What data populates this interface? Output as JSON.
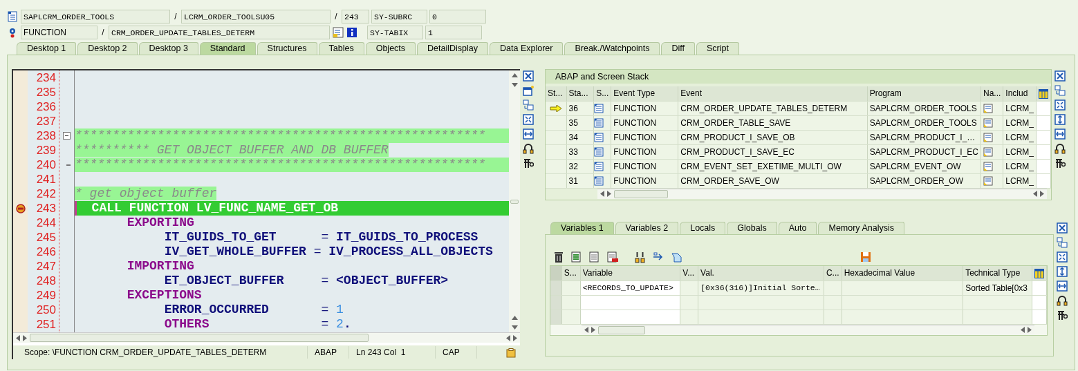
{
  "header": {
    "program": "SAPLCRM_ORDER_TOOLS",
    "include": "LCRM_ORDER_TOOLSU05",
    "line": "243",
    "event_type": "FUNCTION",
    "event": "CRM_ORDER_UPDATE_TABLES_DETERM",
    "separators": [
      "/",
      "/",
      "/"
    ],
    "sys_fields": [
      {
        "name": "SY-SUBRC",
        "value": "0"
      },
      {
        "name": "SY-TABIX",
        "value": "1"
      }
    ]
  },
  "tabs": [
    {
      "label": "Desktop 1",
      "selected": false
    },
    {
      "label": "Desktop 2",
      "selected": false
    },
    {
      "label": "Desktop 3",
      "selected": false
    },
    {
      "label": "Standard",
      "selected": true
    },
    {
      "label": "Structures",
      "selected": false
    },
    {
      "label": "Tables",
      "selected": false
    },
    {
      "label": "Objects",
      "selected": false
    },
    {
      "label": "DetailDisplay",
      "selected": false
    },
    {
      "label": "Data Explorer",
      "selected": false
    },
    {
      "label": "Break./Watchpoints",
      "selected": false
    },
    {
      "label": "Diff",
      "selected": false
    },
    {
      "label": "Script",
      "selected": false
    }
  ],
  "code": {
    "lines": [
      {
        "number": "234",
        "breakpoint": false,
        "collapsible": false,
        "kind": "blank"
      },
      {
        "number": "235",
        "breakpoint": false,
        "collapsible": false,
        "kind": "blank"
      },
      {
        "number": "236",
        "breakpoint": false,
        "collapsible": false,
        "kind": "blank"
      },
      {
        "number": "237",
        "breakpoint": false,
        "collapsible": false,
        "kind": "blank"
      },
      {
        "number": "238",
        "breakpoint": false,
        "collapsible": true,
        "kind": "banner-rule",
        "tokens": [
          {
            "text": "*******************************************************",
            "kind": "comment"
          }
        ]
      },
      {
        "number": "239",
        "breakpoint": false,
        "collapsible": false,
        "kind": "banner-title",
        "tokens": [
          {
            "text": "********** GET OBJECT BUFFER AND DB BUFFER",
            "kind": "comment"
          }
        ]
      },
      {
        "number": "240",
        "breakpoint": false,
        "collapsible": false,
        "kind": "banner-rule",
        "tokens": [
          {
            "text": "*******************************************************",
            "kind": "comment"
          }
        ]
      },
      {
        "number": "241",
        "breakpoint": false,
        "collapsible": false,
        "kind": "blank"
      },
      {
        "number": "242",
        "breakpoint": false,
        "collapsible": false,
        "kind": "comment",
        "tokens": [
          {
            "text": "* get object buffer",
            "kind": "comment"
          }
        ]
      },
      {
        "number": "243",
        "breakpoint": true,
        "collapsible": false,
        "kind": "current",
        "tokens": [
          {
            "text": "  CALL FUNCTION LV_FUNC_NAME_GET_OB",
            "kind": "plain"
          }
        ]
      },
      {
        "number": "244",
        "breakpoint": false,
        "collapsible": false,
        "kind": "code",
        "tokens": [
          {
            "text": "       EXPORTING",
            "kind": "keyword"
          }
        ]
      },
      {
        "number": "245",
        "breakpoint": false,
        "collapsible": false,
        "kind": "code",
        "tokens": [
          {
            "text": "            IT_GUIDS_TO_GET",
            "kind": "ident"
          },
          {
            "text": "      =",
            "kind": "op"
          },
          {
            "text": " IT_GUIDS_TO_PROCESS",
            "kind": "ident"
          }
        ]
      },
      {
        "number": "246",
        "breakpoint": false,
        "collapsible": false,
        "kind": "code",
        "tokens": [
          {
            "text": "            IV_GET_WHOLE_BUFFER",
            "kind": "ident"
          },
          {
            "text": " =",
            "kind": "op"
          },
          {
            "text": " IV_PROCESS_ALL_OBJECTS",
            "kind": "ident"
          }
        ]
      },
      {
        "number": "247",
        "breakpoint": false,
        "collapsible": false,
        "kind": "code",
        "tokens": [
          {
            "text": "       IMPORTING",
            "kind": "keyword"
          }
        ]
      },
      {
        "number": "248",
        "breakpoint": false,
        "collapsible": false,
        "kind": "code",
        "tokens": [
          {
            "text": "            ET_OBJECT_BUFFER",
            "kind": "ident"
          },
          {
            "text": "     =",
            "kind": "op"
          },
          {
            "text": " <OBJECT_BUFFER>",
            "kind": "ident"
          }
        ]
      },
      {
        "number": "249",
        "breakpoint": false,
        "collapsible": false,
        "kind": "code",
        "tokens": [
          {
            "text": "       EXCEPTIONS",
            "kind": "keyword"
          }
        ]
      },
      {
        "number": "250",
        "breakpoint": false,
        "collapsible": false,
        "kind": "code",
        "tokens": [
          {
            "text": "            ERROR_OCCURRED",
            "kind": "ident"
          },
          {
            "text": "       =",
            "kind": "op"
          },
          {
            "text": " 1",
            "kind": "number"
          }
        ]
      },
      {
        "number": "251",
        "breakpoint": false,
        "collapsible": false,
        "kind": "code",
        "tokens": [
          {
            "text": "            OTHERS",
            "kind": "keyword"
          },
          {
            "text": "               =",
            "kind": "op"
          },
          {
            "text": " 2",
            "kind": "number"
          },
          {
            "text": ".",
            "kind": "ident"
          }
        ]
      }
    ]
  },
  "status_bar": {
    "scope": "Scope: \\FUNCTION CRM_ORDER_UPDATE_TABLES_DETERM",
    "language": "ABAP",
    "position": "Ln 243 Col  1",
    "caps": "CAP"
  },
  "stack": {
    "title": "ABAP and Screen Stack",
    "columns": [
      "St...",
      "Sta...",
      "S...",
      "Event Type",
      "Event",
      "Program",
      "Na...",
      "Includ"
    ],
    "rows": [
      {
        "current": true,
        "level": "36",
        "event_type": "FUNCTION",
        "event": "CRM_ORDER_UPDATE_TABLES_DETERM",
        "program": "SAPLCRM_ORDER_TOOLS",
        "include": "LCRM_"
      },
      {
        "current": false,
        "level": "35",
        "event_type": "FUNCTION",
        "event": "CRM_ORDER_TABLE_SAVE",
        "program": "SAPLCRM_ORDER_TOOLS",
        "include": "LCRM_"
      },
      {
        "current": false,
        "level": "34",
        "event_type": "FUNCTION",
        "event": "CRM_PRODUCT_I_SAVE_OB",
        "program": "SAPLCRM_PRODUCT_I_…",
        "include": "LCRM_"
      },
      {
        "current": false,
        "level": "33",
        "event_type": "FUNCTION",
        "event": "CRM_PRODUCT_I_SAVE_EC",
        "program": "SAPLCRM_PRODUCT_I_EC",
        "include": "LCRM_"
      },
      {
        "current": false,
        "level": "32",
        "event_type": "FUNCTION",
        "event": "CRM_EVENT_SET_EXETIME_MULTI_OW",
        "program": "SAPLCRM_EVENT_OW",
        "include": "LCRM_"
      },
      {
        "current": false,
        "level": "31",
        "event_type": "FUNCTION",
        "event": "CRM_ORDER_SAVE_OW",
        "program": "SAPLCRM_ORDER_OW",
        "include": "LCRM_"
      }
    ]
  },
  "variable_tabs": [
    {
      "label": "Variables 1",
      "selected": true
    },
    {
      "label": "Variables 2",
      "selected": false
    },
    {
      "label": "Locals",
      "selected": false
    },
    {
      "label": "Globals",
      "selected": false
    },
    {
      "label": "Auto",
      "selected": false
    },
    {
      "label": "Memory Analysis",
      "selected": false
    }
  ],
  "variables": {
    "columns": [
      "S...",
      "Variable",
      "V...",
      "Val.",
      "C...",
      "Hexadecimal Value",
      "Technical Type"
    ],
    "rows": [
      {
        "variable": "<RECORDS_TO_UPDATE>",
        "value": "[0x36(316)]Initial Sorte…",
        "technical_type": "Sorted Table[0x3"
      }
    ]
  }
}
